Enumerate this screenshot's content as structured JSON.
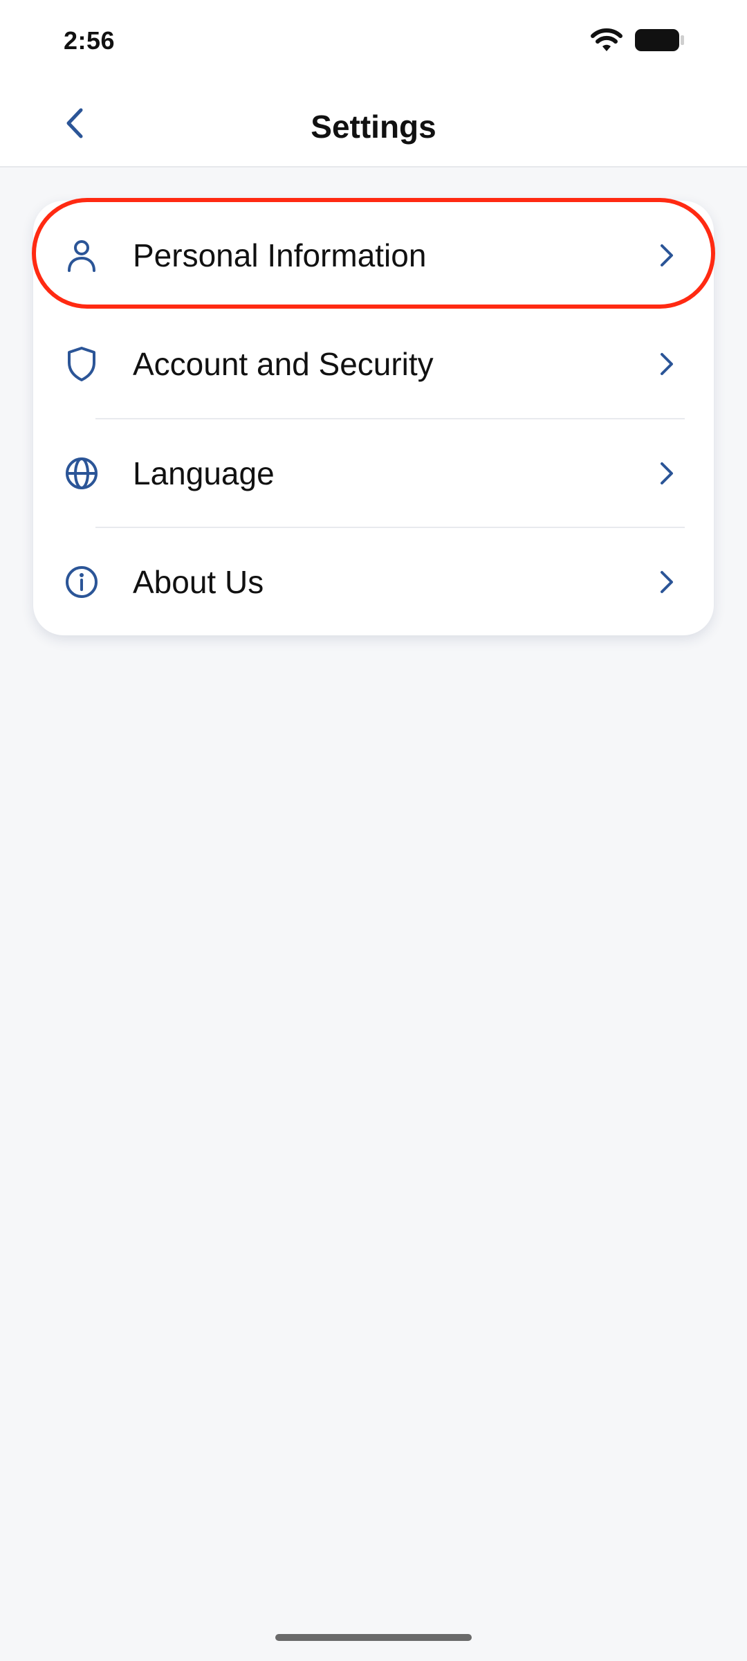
{
  "status_bar": {
    "time": "2:56",
    "icons": [
      "wifi-icon",
      "battery-icon"
    ]
  },
  "header": {
    "title": "Settings",
    "back_icon": "chevron-left-icon"
  },
  "settings": {
    "items": [
      {
        "label": "Personal Information",
        "icon": "person-icon",
        "highlighted": true
      },
      {
        "label": "Account and Security",
        "icon": "shield-icon"
      },
      {
        "label": "Language",
        "icon": "globe-icon"
      },
      {
        "label": "About Us",
        "icon": "info-icon"
      }
    ]
  },
  "colors": {
    "accent": "#2b5597",
    "highlight": "#ff2a12",
    "background": "#f6f7f9",
    "card": "#ffffff"
  }
}
